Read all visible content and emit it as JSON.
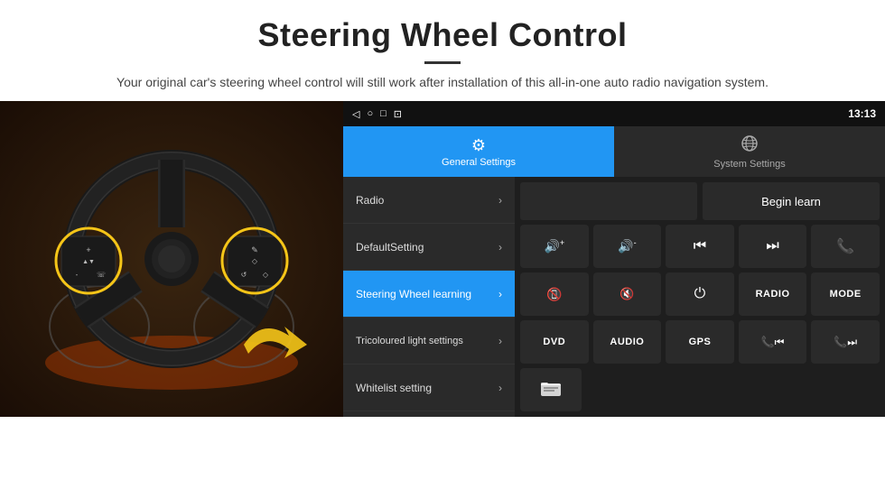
{
  "header": {
    "title": "Steering Wheel Control",
    "divider": true,
    "subtitle": "Your original car's steering wheel control will still work after installation of this all-in-one auto radio navigation system."
  },
  "status_bar": {
    "nav_icons": [
      "◁",
      "○",
      "□",
      "⊡"
    ],
    "signal_time": "13:13"
  },
  "tabs": [
    {
      "label": "General Settings",
      "active": true,
      "icon": "⚙"
    },
    {
      "label": "System Settings",
      "active": false,
      "icon": "🌐"
    }
  ],
  "menu": [
    {
      "label": "Radio",
      "active": false
    },
    {
      "label": "DefaultSetting",
      "active": false
    },
    {
      "label": "Steering Wheel learning",
      "active": true
    },
    {
      "label": "Tricoloured light settings",
      "active": false
    },
    {
      "label": "Whitelist setting",
      "active": false
    }
  ],
  "controls": {
    "begin_learn": "Begin learn",
    "row1": [
      "🔊+",
      "🔊-",
      "⏮",
      "⏭",
      "📞"
    ],
    "row1_icons": [
      "vol_up",
      "vol_down",
      "prev_track",
      "next_track",
      "phone"
    ],
    "row2_labels": [
      "",
      "🔊✕",
      "⏻",
      "RADIO",
      "MODE"
    ],
    "row2_icons": [
      "hang_up",
      "mute",
      "power",
      "radio_label",
      "mode_label"
    ],
    "row3_labels": [
      "DVD",
      "AUDIO",
      "GPS",
      "prev_combined",
      "next_combined"
    ],
    "last_icon": "📁"
  },
  "colors": {
    "active_blue": "#2196F3",
    "background_dark": "#1e1e1e",
    "panel_dark": "#2a2a2a",
    "text_white": "#ffffff",
    "text_gray": "#aaaaaa"
  }
}
